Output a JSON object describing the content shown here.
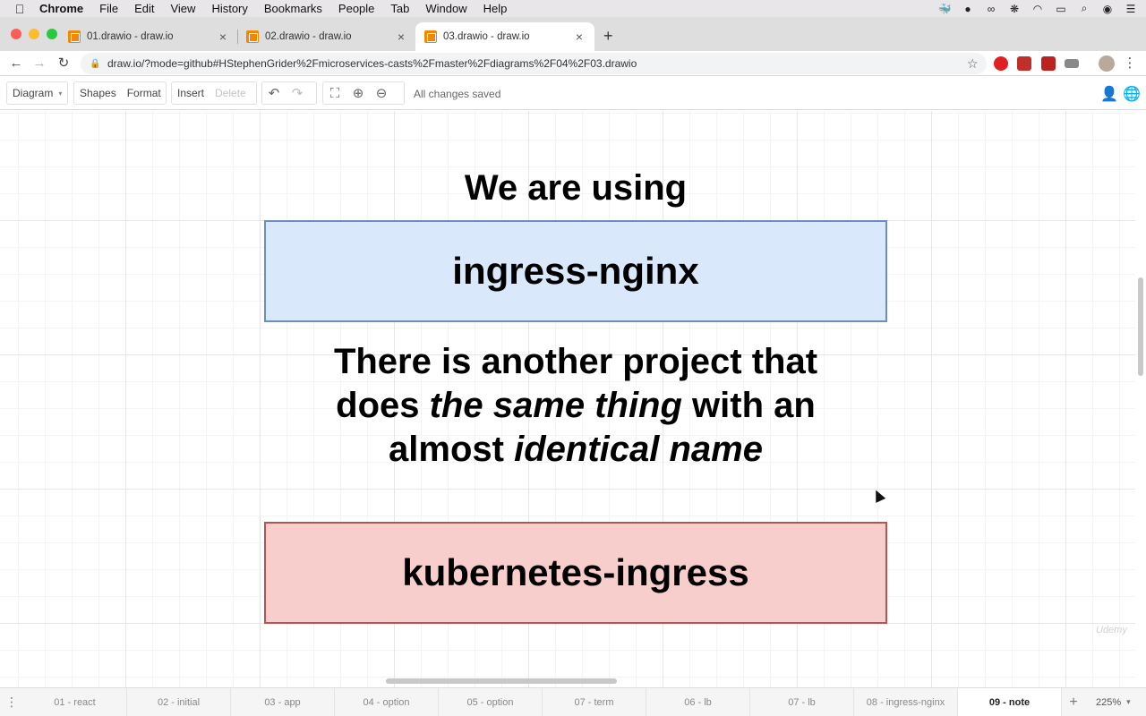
{
  "menubar": {
    "apple": "",
    "items": [
      "Chrome",
      "File",
      "Edit",
      "View",
      "History",
      "Bookmarks",
      "People",
      "Tab",
      "Window",
      "Help"
    ]
  },
  "tabs": [
    {
      "title": "01.drawio - draw.io",
      "close": "×"
    },
    {
      "title": "02.drawio - draw.io",
      "close": "×"
    },
    {
      "title": "03.drawio - draw.io",
      "close": "×"
    }
  ],
  "newtab": "+",
  "address": {
    "url": "draw.io/?mode=github#HStephenGrider%2Fmicroservices-casts%2Fmaster%2Fdiagrams%2F04%2F03.drawio"
  },
  "toolbar": {
    "diagram": "Diagram",
    "shapes": "Shapes",
    "format": "Format",
    "insert": "Insert",
    "delete": "Delete",
    "status": "All changes saved"
  },
  "canvas": {
    "heading": "We are using",
    "box1": "ingress-nginx",
    "note_line1": "There is another project that",
    "note_line2_a": "does",
    "note_line2_em": "the same thing",
    "note_line2_b": "with an",
    "note_line3_a": "almost",
    "note_line3_em": "identical name",
    "box2": "kubernetes-ingress",
    "colors": {
      "box1_fill": "#dae8fc",
      "box1_stroke": "#6c8ebf",
      "box2_fill": "#f8cecc",
      "box2_stroke": "#b85450"
    }
  },
  "pages": [
    "01 - react",
    "02 - initial",
    "03 - app",
    "04 - option",
    "05 - option",
    "07 - term",
    "06 - lb",
    "07 - lb",
    "08 - ingress-nginx",
    "09 - note"
  ],
  "zoom": "225%",
  "page_add": "+"
}
